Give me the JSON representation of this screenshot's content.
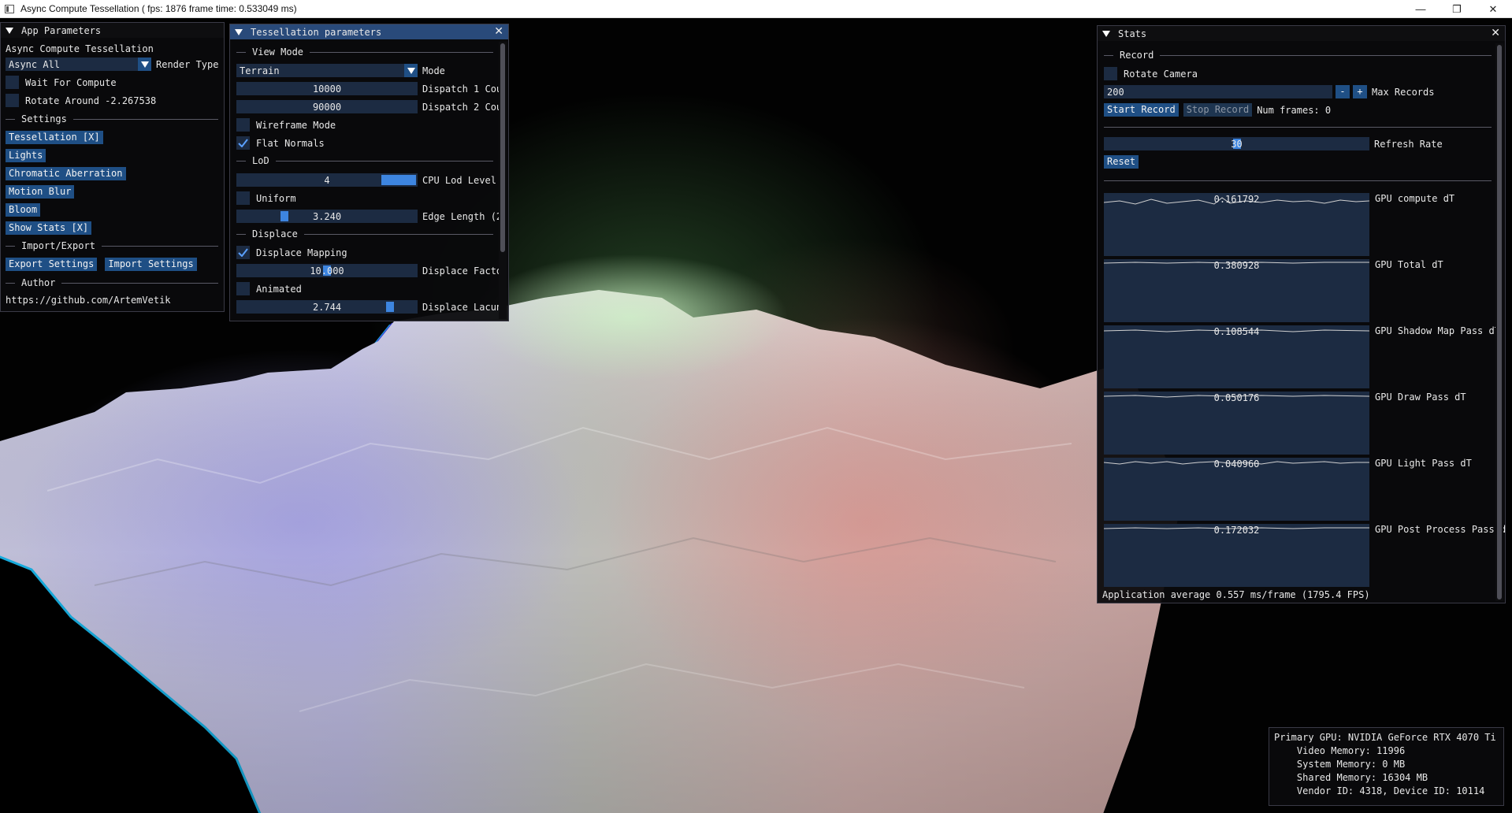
{
  "window": {
    "title": "Async Compute Tessellation ( fps: 1876 frame time: 0.533049 ms)",
    "minimize_glyph": "—",
    "maximize_glyph": "❐",
    "close_glyph": "✕"
  },
  "app_params": {
    "title": "App Parameters",
    "app_name": "Async Compute Tessellation",
    "render_type_value": "Async All",
    "render_type_label": "Render Type",
    "wait_for_compute": "Wait For Compute",
    "rotate_around": "Rotate Around -2.267538",
    "settings_header": "Settings",
    "buttons": {
      "tessellation": "Tessellation [X]",
      "lights": "Lights",
      "chromatic": "Chromatic Aberration",
      "motion_blur": "Motion Blur",
      "bloom": "Bloom",
      "show_stats": "Show Stats [X]"
    },
    "import_export_header": "Import/Export",
    "export_settings": "Export Settings",
    "import_settings": "Import Settings",
    "author_header": "Author",
    "author_link": "https://github.com/ArtemVetik"
  },
  "tess": {
    "title": "Tessellation parameters",
    "view_mode_header": "View Mode",
    "mode_value": "Terrain",
    "mode_label": "Mode",
    "dispatch1_value": "10000",
    "dispatch1_label": "Dispatch 1 Cou",
    "dispatch2_value": "90000",
    "dispatch2_label": "Dispatch 2 Cou",
    "wireframe": "Wireframe Mode",
    "flat_normals": "Flat Normals",
    "lod_header": "LoD",
    "cpu_lod_value": "4",
    "cpu_lod_label": "CPU Lod Level",
    "uniform": "Uniform",
    "edge_length_value": "3.240",
    "edge_length_label": "Edge Length (2",
    "displace_header": "Displace",
    "displace_mapping": "Displace Mapping",
    "displace_factor_value": "10.000",
    "displace_factor_label": "Displace Facto",
    "animated": "Animated",
    "displace_lacun_value": "2.744",
    "displace_lacun_label": "Displace Lacun"
  },
  "stats": {
    "title": "Stats",
    "record_header": "Record",
    "rotate_camera": "Rotate Camera",
    "max_records_value": "200",
    "minus": "-",
    "plus": "+",
    "max_records_label": "Max Records",
    "start_record": "Start Record",
    "stop_record": "Stop Record",
    "num_frames": "Num frames: 0",
    "refresh_rate_value": "30",
    "refresh_rate_label": "Refresh Rate",
    "reset": "Reset",
    "plots": [
      {
        "value": "0.161792",
        "label": "GPU compute dT"
      },
      {
        "value": "0.380928",
        "label": "GPU Total dT"
      },
      {
        "value": "0.108544",
        "label": "GPU Shadow Map Pass dT"
      },
      {
        "value": "0.050176",
        "label": "GPU Draw Pass dT"
      },
      {
        "value": "0.040960",
        "label": "GPU Light Pass dT"
      },
      {
        "value": "0.172032",
        "label": "GPU Post Process Pass d"
      }
    ],
    "app_average": "Application average 0.557 ms/frame (1795.4 FPS)"
  },
  "gpu_info": {
    "line1": "Primary GPU: NVIDIA GeForce RTX 4070 Ti",
    "line2": "    Video Memory: 11996",
    "line3": "    System Memory: 0 MB",
    "line4": "    Shared Memory: 16304 MB",
    "line5": "    Vendor ID: 4318, Device ID: 10114"
  },
  "colors": {
    "title_active": "#294a7a",
    "button": "#1f4f85",
    "frame_bg": "#1c2b42",
    "slider_grab": "#3d85e0"
  },
  "slider_levels": {
    "cpu_lod": 1.0,
    "edge_length": 0.25,
    "displace_factor": 0.5,
    "displace_lacun": 0.87,
    "refresh_rate": 0.5
  },
  "icons": {
    "collapse": "collapse-triangle-icon",
    "close": "close-icon",
    "check": "checkmark-icon",
    "combo": "combo-arrow-icon"
  }
}
